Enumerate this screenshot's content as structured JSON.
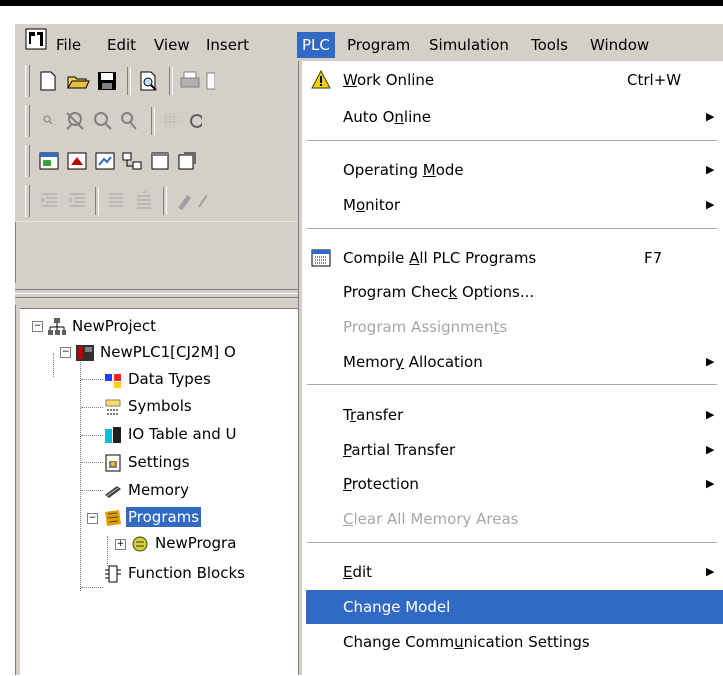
{
  "menubar": {
    "items": [
      "File",
      "Edit",
      "View",
      "Insert",
      "PLC",
      "Program",
      "Simulation",
      "Tools",
      "Window"
    ],
    "active": "PLC"
  },
  "tree": {
    "project": "NewProject",
    "plc": "NewPLC1[CJ2M] O",
    "children": [
      "Data Types",
      "Symbols",
      "IO Table and U",
      "Settings",
      "Memory",
      "Programs"
    ],
    "program": "NewProgra",
    "function_blocks": "Function Blocks"
  },
  "plc_menu": {
    "work_online": {
      "pre": "",
      "u": "W",
      "post": "ork Online",
      "shortcut": "Ctrl+W"
    },
    "auto_online": {
      "pre": "Auto O",
      "u": "n",
      "post": "line"
    },
    "operating_mode": {
      "pre": "Operating ",
      "u": "M",
      "post": "ode"
    },
    "monitor": {
      "pre": "M",
      "u": "o",
      "post": "nitor"
    },
    "compile_all": {
      "pre": "Compile ",
      "u": "A",
      "post": "ll PLC Programs",
      "shortcut": "F7"
    },
    "check_options": {
      "pre": "Program Chec",
      "u": "k",
      "post": " Options..."
    },
    "assignments": {
      "pre": "Program Assignmen",
      "u": "t",
      "post": "s"
    },
    "memory_allocation": {
      "pre": "Memor",
      "u": "y",
      "post": " Allocation"
    },
    "transfer": {
      "pre": "T",
      "u": "r",
      "post": "ansfer"
    },
    "partial_transfer": {
      "pre": "",
      "u": "P",
      "post": "artial Transfer"
    },
    "protection": {
      "pre": "",
      "u": "P",
      "post": "rotection"
    },
    "clear_memory": {
      "pre": "",
      "u": "C",
      "post": "lear All Memory Areas"
    },
    "edit": {
      "pre": "",
      "u": "E",
      "post": "dit"
    },
    "change_model": {
      "pre": "Chan",
      "u": "g",
      "post": "e Model"
    },
    "change_comm": {
      "pre": "Change Comm",
      "u": "u",
      "post": "nication Settings"
    }
  },
  "colors": {
    "highlight": "#316ac5",
    "chrome": "#d4d0c8",
    "disabled": "#a7a6aa"
  }
}
